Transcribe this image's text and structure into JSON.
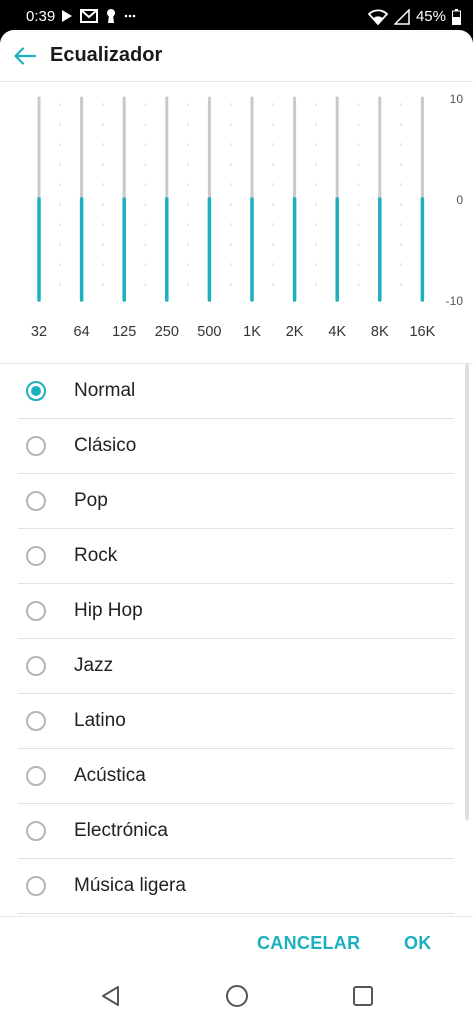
{
  "status_bar": {
    "time": "0:39",
    "battery": "45%",
    "icons": [
      "play-icon",
      "gmail-icon",
      "keyhole-icon",
      "more-dots-icon",
      "wifi-icon",
      "signal-icon",
      "battery-icon"
    ]
  },
  "header": {
    "title": "Ecualizador"
  },
  "equalizer": {
    "bands": [
      "32",
      "64",
      "125",
      "250",
      "500",
      "1K",
      "2K",
      "4K",
      "8K",
      "16K"
    ],
    "levels_db": [
      0,
      0,
      0,
      0,
      0,
      0,
      0,
      0,
      0,
      0
    ],
    "scale": {
      "max": "10",
      "mid": "0",
      "min": "-10",
      "range": [
        -10,
        10
      ]
    },
    "accent_color": "#1ab0bd",
    "track_color": "#c9c9c9"
  },
  "presets": {
    "selected": "Normal",
    "items": [
      "Normal",
      "Clásico",
      "Pop",
      "Rock",
      "Hip Hop",
      "Jazz",
      "Latino",
      "Acústica",
      "Electrónica",
      "Música ligera"
    ]
  },
  "footer": {
    "cancel_label": "CANCELAR",
    "ok_label": "OK"
  },
  "nav_bar": {
    "icons": [
      "back-triangle-icon",
      "home-circle-icon",
      "recents-square-icon"
    ]
  }
}
